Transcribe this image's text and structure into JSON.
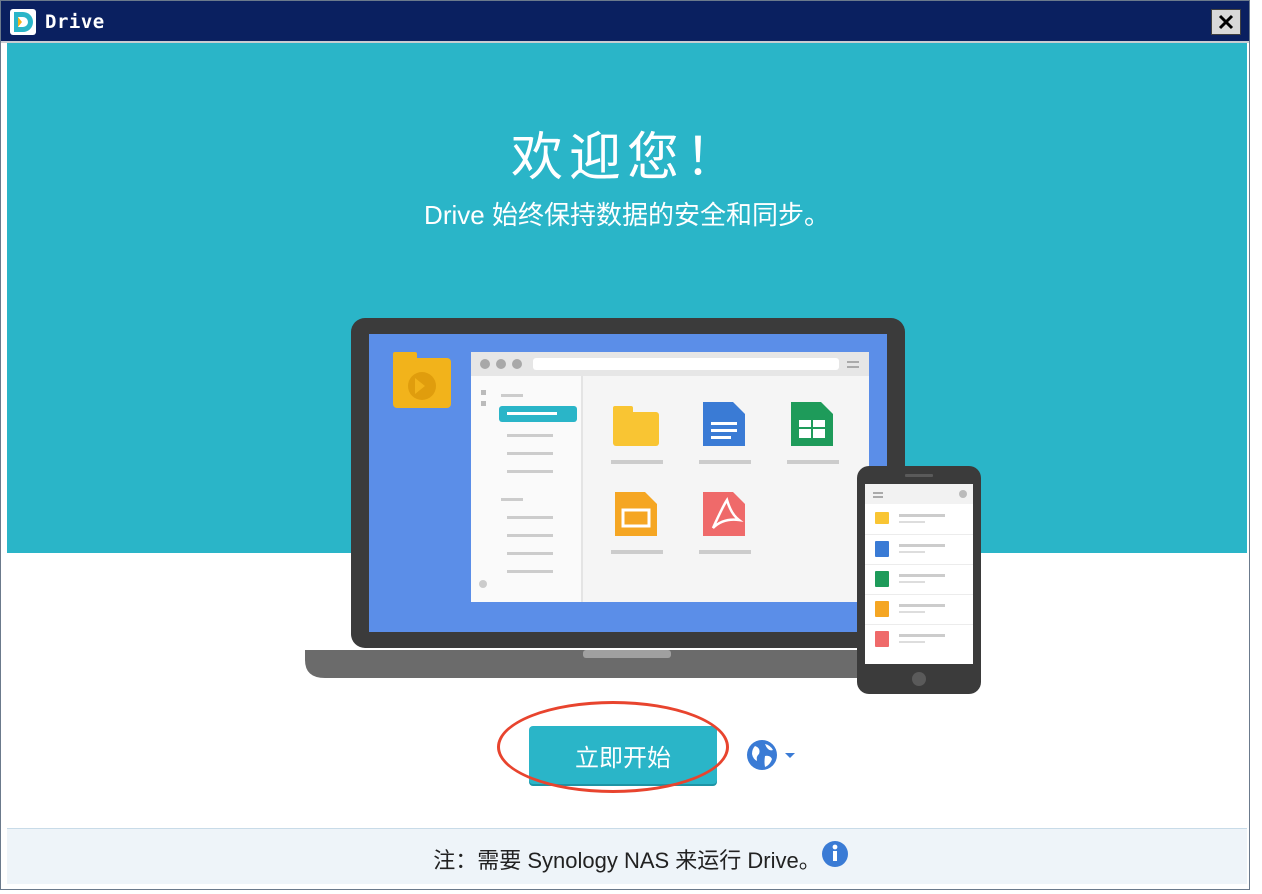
{
  "window": {
    "title": "Drive",
    "close_icon": "close-icon"
  },
  "welcome": {
    "heading": "欢迎您！",
    "subtitle": "Drive 始终保持数据的安全和同步。"
  },
  "actions": {
    "start_label": "立即开始",
    "language_icon": "globe-icon"
  },
  "footer": {
    "note": "注：需要 Synology NAS 来运行 Drive。",
    "info_icon": "info-icon"
  },
  "colors": {
    "teal": "#2ab5c8",
    "titlebar": "#0a2060",
    "accent_blue": "#3a7bd5",
    "annotation_red": "#e8442e"
  }
}
